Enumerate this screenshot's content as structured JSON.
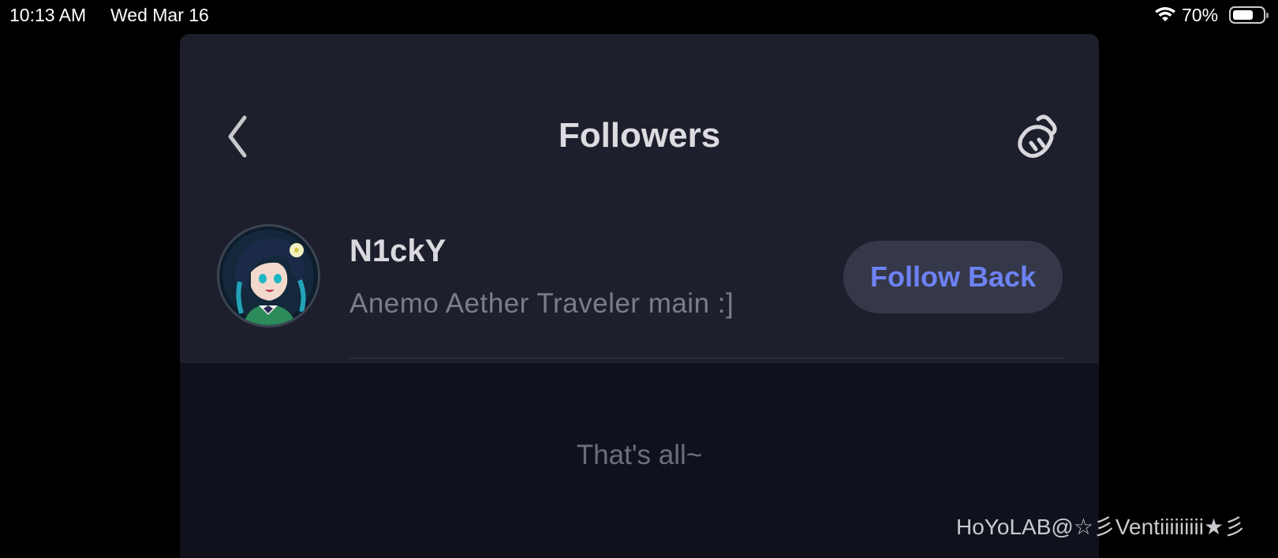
{
  "status_bar": {
    "time": "10:13 AM",
    "date": "Wed Mar 16",
    "battery_percent": "70%",
    "battery_level": 0.7,
    "icons": [
      "wifi-icon",
      "battery-icon"
    ]
  },
  "header": {
    "title": "Followers",
    "back_icon": "chevron-left-icon",
    "clean_icon": "broom-icon"
  },
  "followers": [
    {
      "name": "N1ckY",
      "bio": "Anemo Aether Traveler main :]",
      "button_label": "Follow Back"
    }
  ],
  "footer": {
    "end_text": "That's all~"
  },
  "watermark": "HoYoLAB@☆彡Ventiiiiiiiii★彡",
  "colors": {
    "panel_bg": "#1d1f2c",
    "footer_bg": "#0f111c",
    "accent": "#6e82f5",
    "button_bg": "#353848"
  }
}
